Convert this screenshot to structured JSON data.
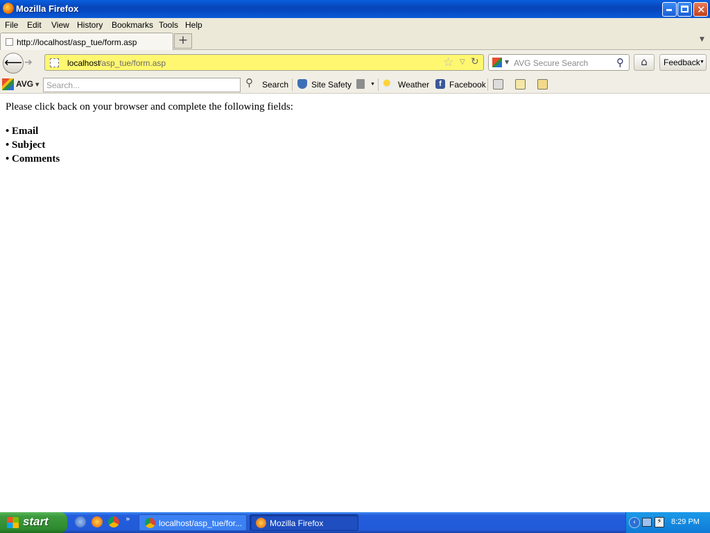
{
  "window": {
    "title": "Mozilla Firefox"
  },
  "menu": [
    "File",
    "Edit",
    "View",
    "History",
    "Bookmarks",
    "Tools",
    "Help"
  ],
  "tab": {
    "label": "http://localhost/asp_tue/form.asp",
    "new_tab_symbol": "+"
  },
  "nav": {
    "url_host": "localhost",
    "url_path": "/asp_tue/form.asp",
    "search_placeholder": "AVG Secure Search",
    "feedback_label": "Feedback"
  },
  "avg": {
    "brand": "AVG",
    "search_placeholder": "Search...",
    "search_button": "Search",
    "site_safety": "Site Safety",
    "weather": "Weather",
    "facebook": "Facebook"
  },
  "content": {
    "intro": "Please click back on your browser and complete the following fields:",
    "fields": [
      "• Email",
      "• Subject",
      "• Comments"
    ]
  },
  "taskbar": {
    "start_label": "start",
    "tasks": [
      "localhost/asp_tue/for...",
      "Mozilla Firefox"
    ],
    "chevron": "»",
    "clock": "8:29 PM"
  }
}
